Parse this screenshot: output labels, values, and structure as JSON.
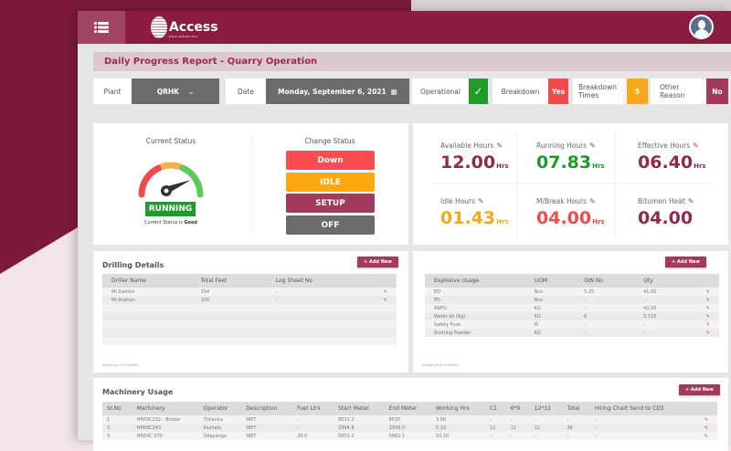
{
  "header": {
    "logo_text": "Access",
    "logo_sub": "ENGINEERING"
  },
  "title": "Daily Progress Report -  Quarry Operation",
  "filters": {
    "plant_label": "Plant",
    "plant_value": "QRHK",
    "date_label": "Date",
    "date_value": "Monday, September 6, 2021",
    "operational_label": "Operational",
    "operational_value": "✓",
    "breakdown_label": "Breakdown",
    "breakdown_value": "Yes",
    "breakdown_times_label": "Breakdown Times",
    "breakdown_times_value": "5",
    "other_reason_label": "Other Reason",
    "other_reason_value": "No"
  },
  "status": {
    "current_title": "Current Status",
    "badge": "RUNNING",
    "caption": "Current Status is",
    "caption_bold": "Good",
    "change_title": "Change Status",
    "buttons": [
      "Down",
      "IDLE",
      "SETUP",
      "OFF"
    ]
  },
  "metrics": [
    {
      "label": "Available Hours",
      "value": "12.00",
      "unit": "Hrs",
      "color": "#8e2a4f"
    },
    {
      "label": "Running Hours",
      "value": "07.83",
      "unit": "Hrs",
      "color": "#1f9a2b"
    },
    {
      "label": "Effective Hours",
      "value": "06.40",
      "unit": "Hrs",
      "color": "#8e2a4f"
    },
    {
      "label": "Idle Hours",
      "value": "01.43",
      "unit": "Hrs",
      "color": "#f2a81d"
    },
    {
      "label": "M/Break Hours",
      "value": "04.00",
      "unit": "Hrs",
      "color": "#ef4b4b"
    },
    {
      "label": "Bitumen Heat",
      "value": "04.00",
      "unit": "",
      "color": "#8e2a4f"
    }
  ],
  "add_new": "+ Add New",
  "drilling": {
    "title": "Drilling Details",
    "headers": [
      "Driller Name",
      "Total Feet",
      "Log Sheet No"
    ],
    "rows": [
      [
        "Mr.Damini",
        "154",
        "-"
      ],
      [
        "Mr.Roshan",
        "100",
        "-"
      ]
    ],
    "footer": "Showing 2 of 2 entries"
  },
  "explosive": {
    "headers": [
      "Explosive Usage",
      "UOM",
      "GIN No",
      "Qty"
    ],
    "rows": [
      [
        "ED",
        "Nos",
        "5.25",
        "41.00"
      ],
      [
        "PD",
        "Nos",
        "-",
        "-"
      ],
      [
        "ANFO",
        "KG",
        "-",
        "42.00"
      ],
      [
        "Water Jel (Kg)",
        "KG",
        "6",
        "5.125"
      ],
      [
        "Safety Fuse",
        "M",
        "-",
        "-"
      ],
      [
        "Blasting Powder",
        "KG",
        "-",
        "-"
      ]
    ],
    "footer": "Showing 6 of 6 entries"
  },
  "machinery": {
    "title": "Machinery Usage",
    "headers": [
      "Sr.No",
      "Machinery",
      "Operator",
      "Description",
      "Fuel Ltrs",
      "Start Meter",
      "End Meter",
      "Working Hrs",
      "C1",
      "6*9",
      "12*12",
      "Total",
      "Hiring Chart Send to CED"
    ],
    "rows": [
      [
        "1",
        "HREXC232 - Broker",
        "Thilanka",
        "WET",
        "-",
        "8531.2",
        "8535",
        "3.80",
        "-",
        "-",
        "-",
        "-",
        "-"
      ],
      [
        "2",
        "HREXC243",
        "Koshala",
        "WET",
        "-",
        "2994.8",
        "2999.0",
        "5.10",
        "12",
        "12",
        "12",
        "36",
        "-"
      ],
      [
        "3",
        "HREXC 270",
        "Udayanga",
        "WET",
        "20.0",
        "5851.2",
        "5862.1",
        "10.10",
        "-",
        "-",
        "-",
        "-",
        "-"
      ]
    ]
  }
}
